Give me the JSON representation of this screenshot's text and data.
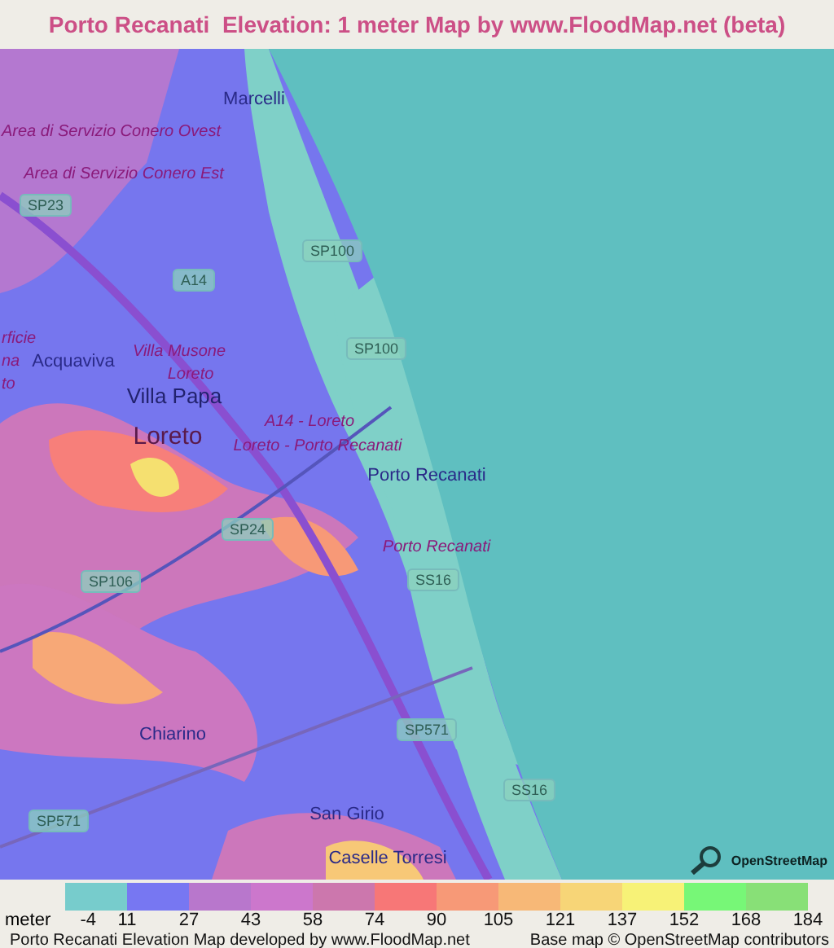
{
  "title": "Porto Recanati  Elevation: 1 meter Map by www.FloodMap.net (beta)",
  "map": {
    "labels": [
      {
        "text": "Marcelli",
        "kind": "place"
      },
      {
        "text": "Area di Servizio Conero Ovest",
        "kind": "poi"
      },
      {
        "text": "Area di Servizio Conero Est",
        "kind": "poi"
      },
      {
        "text": "SP23",
        "kind": "road"
      },
      {
        "text": "SP100",
        "kind": "road"
      },
      {
        "text": "A14",
        "kind": "road"
      },
      {
        "text": "SP100",
        "kind": "road"
      },
      {
        "text": "Acquaviva",
        "kind": "place"
      },
      {
        "text": "Villa Musone",
        "kind": "poi"
      },
      {
        "text": "Loreto",
        "kind": "poi"
      },
      {
        "text": "rficie",
        "kind": "poi"
      },
      {
        "text": "na",
        "kind": "poi"
      },
      {
        "text": "to",
        "kind": "poi"
      },
      {
        "text": "Villa Papa",
        "kind": "town"
      },
      {
        "text": "Loreto",
        "kind": "city"
      },
      {
        "text": "A14 - Loreto",
        "kind": "poi"
      },
      {
        "text": "Loreto - Porto Recanati",
        "kind": "poi"
      },
      {
        "text": "Porto Recanati",
        "kind": "place"
      },
      {
        "text": "SP24",
        "kind": "road"
      },
      {
        "text": "Porto Recanati",
        "kind": "poi"
      },
      {
        "text": "SS16",
        "kind": "road"
      },
      {
        "text": "SP106",
        "kind": "road"
      },
      {
        "text": "SP571",
        "kind": "road"
      },
      {
        "text": "Chiarino",
        "kind": "place"
      },
      {
        "text": "SS16",
        "kind": "road"
      },
      {
        "text": "San Girio",
        "kind": "place"
      },
      {
        "text": "SP571",
        "kind": "road"
      },
      {
        "text": "Caselle Torresi",
        "kind": "place"
      }
    ],
    "logo_text": "OpenStreetMap"
  },
  "legend": {
    "unit": "meter",
    "swatches": [
      {
        "color": "#77cccc"
      },
      {
        "color": "#7777f2"
      },
      {
        "color": "#b877cc"
      },
      {
        "color": "#cc77cc"
      },
      {
        "color": "#cc77ad"
      },
      {
        "color": "#f77777"
      },
      {
        "color": "#f79977"
      },
      {
        "color": "#f7b877"
      },
      {
        "color": "#f7d577"
      },
      {
        "color": "#f7f277"
      },
      {
        "color": "#77f777"
      },
      {
        "color": "#88e077"
      }
    ],
    "ticks": [
      "-4",
      "11",
      "27",
      "43",
      "58",
      "74",
      "90",
      "105",
      "121",
      "137",
      "152",
      "168",
      "184"
    ]
  },
  "footer": {
    "left": "Porto Recanati Elevation Map developed by www.FloodMap.net",
    "right": "Base map © OpenStreetMap contributors"
  }
}
